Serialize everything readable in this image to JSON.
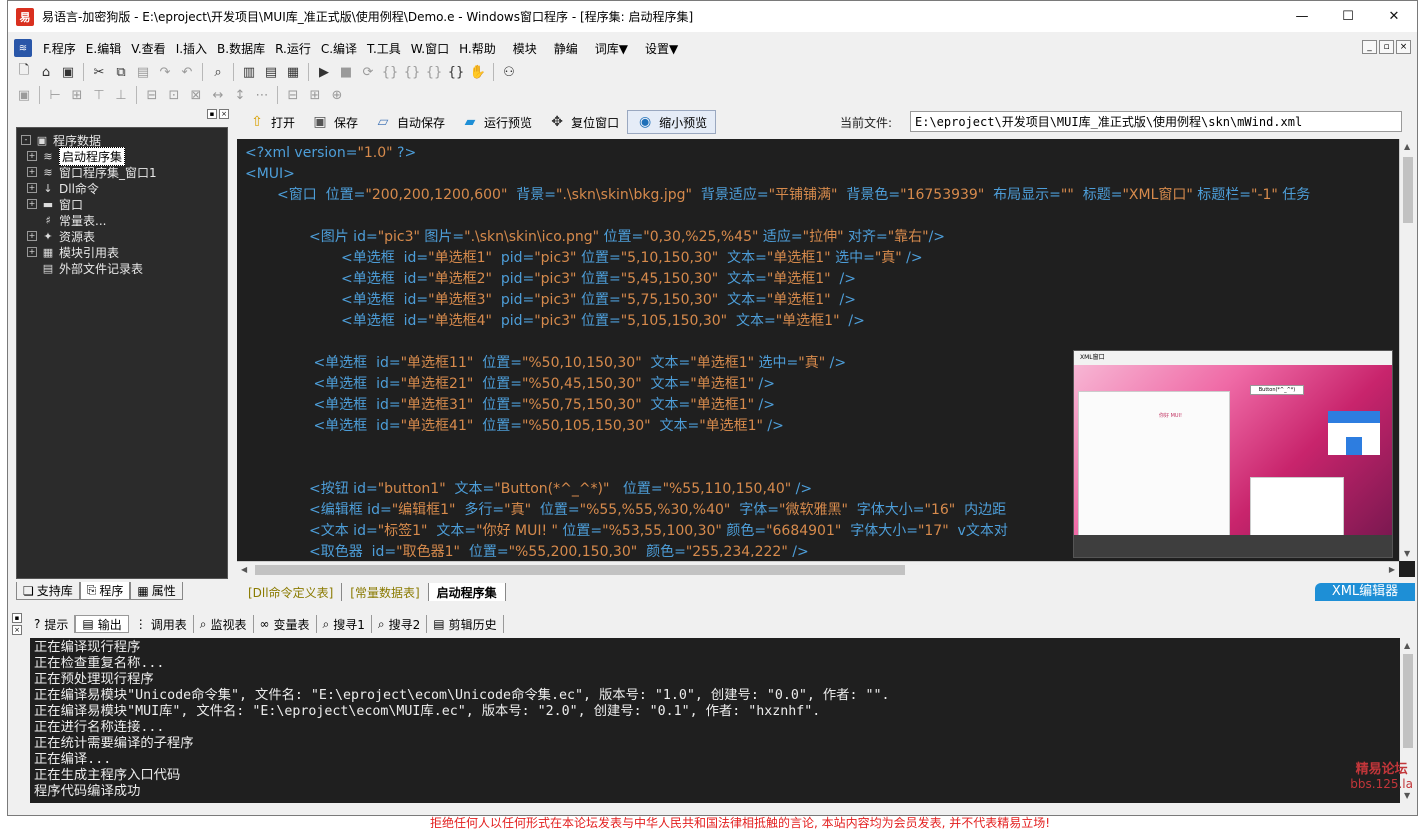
{
  "window": {
    "title": "易语言-加密狗版 - E:\\eproject\\开发项目\\MUI库_准正式版\\使用例程\\Demo.e - Windows窗口程序 - [程序集: 启动程序集]",
    "app_icon": "易",
    "minimize": "—",
    "maximize": "☐",
    "close": "✕"
  },
  "menu": {
    "items": [
      "F.程序",
      "E.编辑",
      "V.查看",
      "I.插入",
      "B.数据库",
      "R.运行",
      "C.编译",
      "T.工具",
      "W.窗口",
      "H.帮助"
    ],
    "extra": [
      "模块",
      "静编",
      "词库▼",
      "设置▼"
    ],
    "mdi": [
      "_",
      "▫",
      "×"
    ]
  },
  "left_panel": {
    "tree": [
      {
        "label": "程序数据",
        "icon": "folder-icon",
        "glyph": "▣",
        "expander": "-",
        "level": 0,
        "selected": false
      },
      {
        "label": "启动程序集",
        "icon": "assembly-icon",
        "glyph": "≋",
        "expander": "+",
        "level": 1,
        "selected": true
      },
      {
        "label": "窗口程序集_窗口1",
        "icon": "assembly-icon",
        "glyph": "≋",
        "expander": "+",
        "level": 1,
        "selected": false
      },
      {
        "label": "Dll命令",
        "icon": "dll-icon",
        "glyph": "↓",
        "expander": "+",
        "level": 1,
        "selected": false
      },
      {
        "label": "窗口",
        "icon": "window-icon",
        "glyph": "▬",
        "expander": "+",
        "level": 1,
        "selected": false
      },
      {
        "label": "常量表...",
        "icon": "constant-icon",
        "glyph": "♯",
        "expander": "",
        "level": 1,
        "selected": false
      },
      {
        "label": "资源表",
        "icon": "resource-icon",
        "glyph": "✦",
        "expander": "+",
        "level": 1,
        "selected": false
      },
      {
        "label": "模块引用表",
        "icon": "module-icon",
        "glyph": "▦",
        "expander": "+",
        "level": 1,
        "selected": false
      },
      {
        "label": "外部文件记录表",
        "icon": "file-icon",
        "glyph": "▤",
        "expander": "",
        "level": 1,
        "selected": false
      }
    ],
    "tabs": [
      "支持库",
      "程序",
      "属性"
    ]
  },
  "editor_toolbar": {
    "buttons": [
      {
        "label": "打开",
        "icon": "open-icon",
        "glyph": "⇧"
      },
      {
        "label": "保存",
        "icon": "save-icon",
        "glyph": "▣"
      },
      {
        "label": "自动保存",
        "icon": "autosave-icon",
        "glyph": "▱"
      },
      {
        "label": "运行预览",
        "icon": "run-preview-icon",
        "glyph": "▰"
      },
      {
        "label": "复位窗口",
        "icon": "move-icon",
        "glyph": "✥"
      },
      {
        "label": "缩小预览",
        "icon": "globe-icon",
        "glyph": "◉"
      }
    ],
    "current_file_label": "当前文件:",
    "current_file_path": "E:\\eproject\\开发项目\\MUI库_准正式版\\使用例程\\skn\\mWind.xml"
  },
  "code": [
    {
      "indent": 0,
      "text": "<?xml version=\"1.0\" ?>"
    },
    {
      "indent": 0,
      "text": "<MUI>"
    },
    {
      "indent": 2,
      "text": "<窗口  位置=\"200,200,1200,600\"  背景=\".\\skn\\skin\\bkg.jpg\"  背景适应=\"平铺铺满\"  背景色=\"16753939\"  布局显示=\"\"  标题=\"XML窗口\" 标题栏=\"-1\" 任务"
    },
    {
      "indent": 0,
      "text": ""
    },
    {
      "indent": 4,
      "text": "<图片 id=\"pic3\" 图片=\".\\skn\\skin\\ico.png\" 位置=\"0,30,%25,%45\" 适应=\"拉伸\" 对齐=\"靠右\"/>"
    },
    {
      "indent": 6,
      "text": "<单选框  id=\"单选框1\"  pid=\"pic3\" 位置=\"5,10,150,30\"  文本=\"单选框1\" 选中=\"真\" />"
    },
    {
      "indent": 6,
      "text": "<单选框  id=\"单选框2\"  pid=\"pic3\" 位置=\"5,45,150,30\"  文本=\"单选框1\"  />"
    },
    {
      "indent": 6,
      "text": "<单选框  id=\"单选框3\"  pid=\"pic3\" 位置=\"5,75,150,30\"  文本=\"单选框1\"  />"
    },
    {
      "indent": 6,
      "text": "<单选框  id=\"单选框4\"  pid=\"pic3\" 位置=\"5,105,150,30\"  文本=\"单选框1\"  />"
    },
    {
      "indent": 0,
      "text": ""
    },
    {
      "indent": 4,
      "text": " <单选框  id=\"单选框11\"  位置=\"%50,10,150,30\"  文本=\"单选框1\" 选中=\"真\" />"
    },
    {
      "indent": 4,
      "text": " <单选框  id=\"单选框21\"  位置=\"%50,45,150,30\"  文本=\"单选框1\" />"
    },
    {
      "indent": 4,
      "text": " <单选框  id=\"单选框31\"  位置=\"%50,75,150,30\"  文本=\"单选框1\" />"
    },
    {
      "indent": 4,
      "text": " <单选框  id=\"单选框41\"  位置=\"%50,105,150,30\"  文本=\"单选框1\" />"
    },
    {
      "indent": 0,
      "text": ""
    },
    {
      "indent": 0,
      "text": ""
    },
    {
      "indent": 4,
      "text": "<按钮 id=\"button1\"  文本=\"Button(*^_^*)\"   位置=\"%55,110,150,40\" />"
    },
    {
      "indent": 4,
      "text": "<编辑框 id=\"编辑框1\"  多行=\"真\"  位置=\"%55,%55,%30,%40\"  字体=\"微软雅黑\"  字体大小=\"16\"  内边距"
    },
    {
      "indent": 4,
      "text": "<文本 id=\"标签1\"  文本=\"你好 MUI! \" 位置=\"%53,55,100,30\" 颜色=\"6684901\"  字体大小=\"17\"  v文本对"
    },
    {
      "indent": 4,
      "text": "<取色器  id=\"取色器1\"  位置=\"%55,200,150,30\"  颜色=\"255,234,222\" />"
    }
  ],
  "editor_tabs": [
    "[Dll命令定义表]",
    "[常量数据表]",
    "启动程序集"
  ],
  "xml_editor_badge": "XML编辑器",
  "output_tabs": [
    {
      "label": "提示",
      "icon": "hint-icon",
      "glyph": "?"
    },
    {
      "label": "输出",
      "icon": "output-icon",
      "glyph": "▤"
    },
    {
      "label": "调用表",
      "icon": "callstack-icon",
      "glyph": "⋮"
    },
    {
      "label": "监视表",
      "icon": "watch-icon",
      "glyph": "⌕"
    },
    {
      "label": "变量表",
      "icon": "variable-icon",
      "glyph": "∞"
    },
    {
      "label": "搜寻1",
      "icon": "search1-icon",
      "glyph": "⌕"
    },
    {
      "label": "搜寻2",
      "icon": "search2-icon",
      "glyph": "⌕"
    },
    {
      "label": "剪辑历史",
      "icon": "clipboard-icon",
      "glyph": "▤"
    }
  ],
  "output_lines": [
    "正在编译现行程序",
    "正在检查重复名称...",
    "正在预处理现行程序",
    "正在编译易模块\"Unicode命令集\", 文件名: \"E:\\eproject\\ecom\\Unicode命令集.ec\", 版本号: \"1.0\", 创建号: \"0.0\", 作者: \"\".",
    "正在编译易模块\"MUI库\", 文件名: \"E:\\eproject\\ecom\\MUI库.ec\", 版本号: \"2.0\", 创建号: \"0.1\", 作者: \"hxznhf\".",
    "正在进行名称连接...",
    "正在统计需要编译的子程序",
    "正在编译...",
    "正在生成主程序入口代码",
    "程序代码编译成功"
  ],
  "watermark": {
    "line1": "精易论坛",
    "line2": "bbs.125.la"
  },
  "cutoff_text": "拒绝任何人以任何形式在本论坛发表与中华人民共和国法律相抵触的言论, 本站内容均为会员发表, 并不代表精易立场!",
  "preview": {
    "title": "XML窗口",
    "button": "Button(*^_^*)",
    "hello": "你好 MUI!"
  },
  "colors": {
    "editor_bg": "#1f1f1f",
    "code_tag": "#4d9ed9",
    "code_string": "#d68a4c",
    "badge": "#1e8fd6",
    "accent_red": "#d9301f"
  }
}
